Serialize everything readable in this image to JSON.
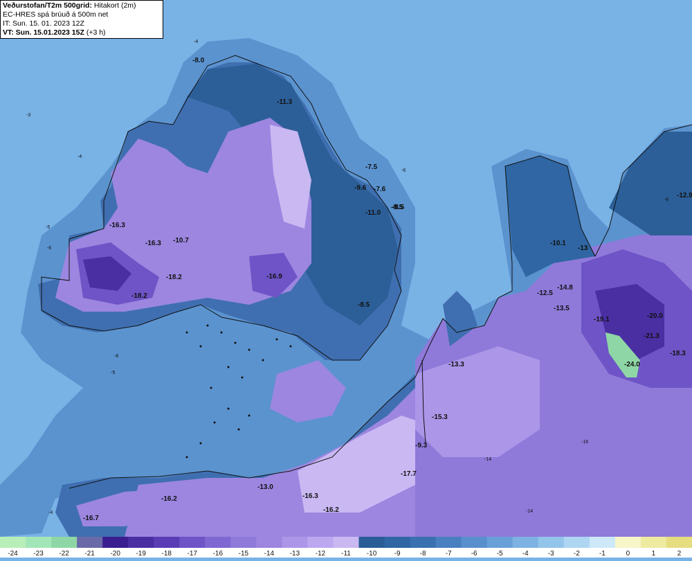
{
  "info": {
    "title_bold": "Veðurstofan/T2m 500grid:",
    "title_rest": " Hitakort (2m)",
    "line2": "EC-HRES spá brúuð á 500m net",
    "line3": "IT: Sun. 15. 01. 2023 12Z",
    "line4_bold": "VT: Sun. 15.01.2023 15Z",
    "line4_rest": " (+3 h)"
  },
  "colors": {
    "sea": "#79b3e6",
    "coast_band": "#5b93cf",
    "land_mid": "#3f6fb0",
    "land_dark": "#2c5f98",
    "violet_light": "#c9b8f2",
    "violet_mid": "#9c86e0",
    "violet_deep": "#6e54c6",
    "violet_core": "#4a2fa3",
    "green": "#8fd6a6",
    "coastline": "#111111"
  },
  "temperature_labels": [
    {
      "text": "-8.0"
    },
    {
      "text": "-11.3"
    },
    {
      "text": "-16.3"
    },
    {
      "text": "-16.3"
    },
    {
      "text": "-10.7"
    },
    {
      "text": "-18.2"
    },
    {
      "text": "-18.2"
    },
    {
      "text": "-16.9"
    },
    {
      "text": "-9.6"
    },
    {
      "text": "-7.6"
    },
    {
      "text": "-11.0"
    },
    {
      "text": "-8.5"
    },
    {
      "text": "-7.5"
    },
    {
      "text": "-8.5"
    },
    {
      "text": "-8.5"
    },
    {
      "text": "-10.1"
    },
    {
      "text": "-13"
    },
    {
      "text": "-12.9"
    },
    {
      "text": "-12.5"
    },
    {
      "text": "-14.8"
    },
    {
      "text": "-13.5"
    },
    {
      "text": "-19.1"
    },
    {
      "text": "-20.0"
    },
    {
      "text": "-21.3"
    },
    {
      "text": "-18.3"
    },
    {
      "text": "-24.0"
    },
    {
      "text": "-13.3"
    },
    {
      "text": "-15.3"
    },
    {
      "text": "-9.3"
    },
    {
      "text": "-17.7"
    },
    {
      "text": "-13.0"
    },
    {
      "text": "-16.2"
    },
    {
      "text": "-16.3"
    },
    {
      "text": "-16.2"
    },
    {
      "text": "-16.7"
    }
  ],
  "legend": {
    "labels": [
      "-24",
      "-23",
      "-22",
      "-21",
      "-20",
      "-19",
      "-18",
      "-17",
      "-16",
      "-15",
      "-14",
      "-13",
      "-12",
      "-11",
      "-10",
      "-9",
      "-8",
      "-7",
      "-6",
      "-5",
      "-4",
      "-3",
      "-2",
      "-1",
      "0",
      "1",
      "2"
    ],
    "colors": [
      "#b8eeb8",
      "#a2e6b8",
      "#8fd6a6",
      "#6a6aa8",
      "#3a1e8f",
      "#4a2fa3",
      "#5a3db4",
      "#6e54c6",
      "#7f68d2",
      "#8f7ada",
      "#9c86e0",
      "#ac96e8",
      "#bba8ef",
      "#c9b8f2",
      "#2a5d96",
      "#2f66a3",
      "#3a70b0",
      "#4a7fc0",
      "#5a8fcd",
      "#6aa0d8",
      "#7db2e2",
      "#93c4ea",
      "#aed6f2",
      "#cde8f8",
      "#f6f6c8",
      "#eeeaa0",
      "#e6dc80"
    ]
  }
}
